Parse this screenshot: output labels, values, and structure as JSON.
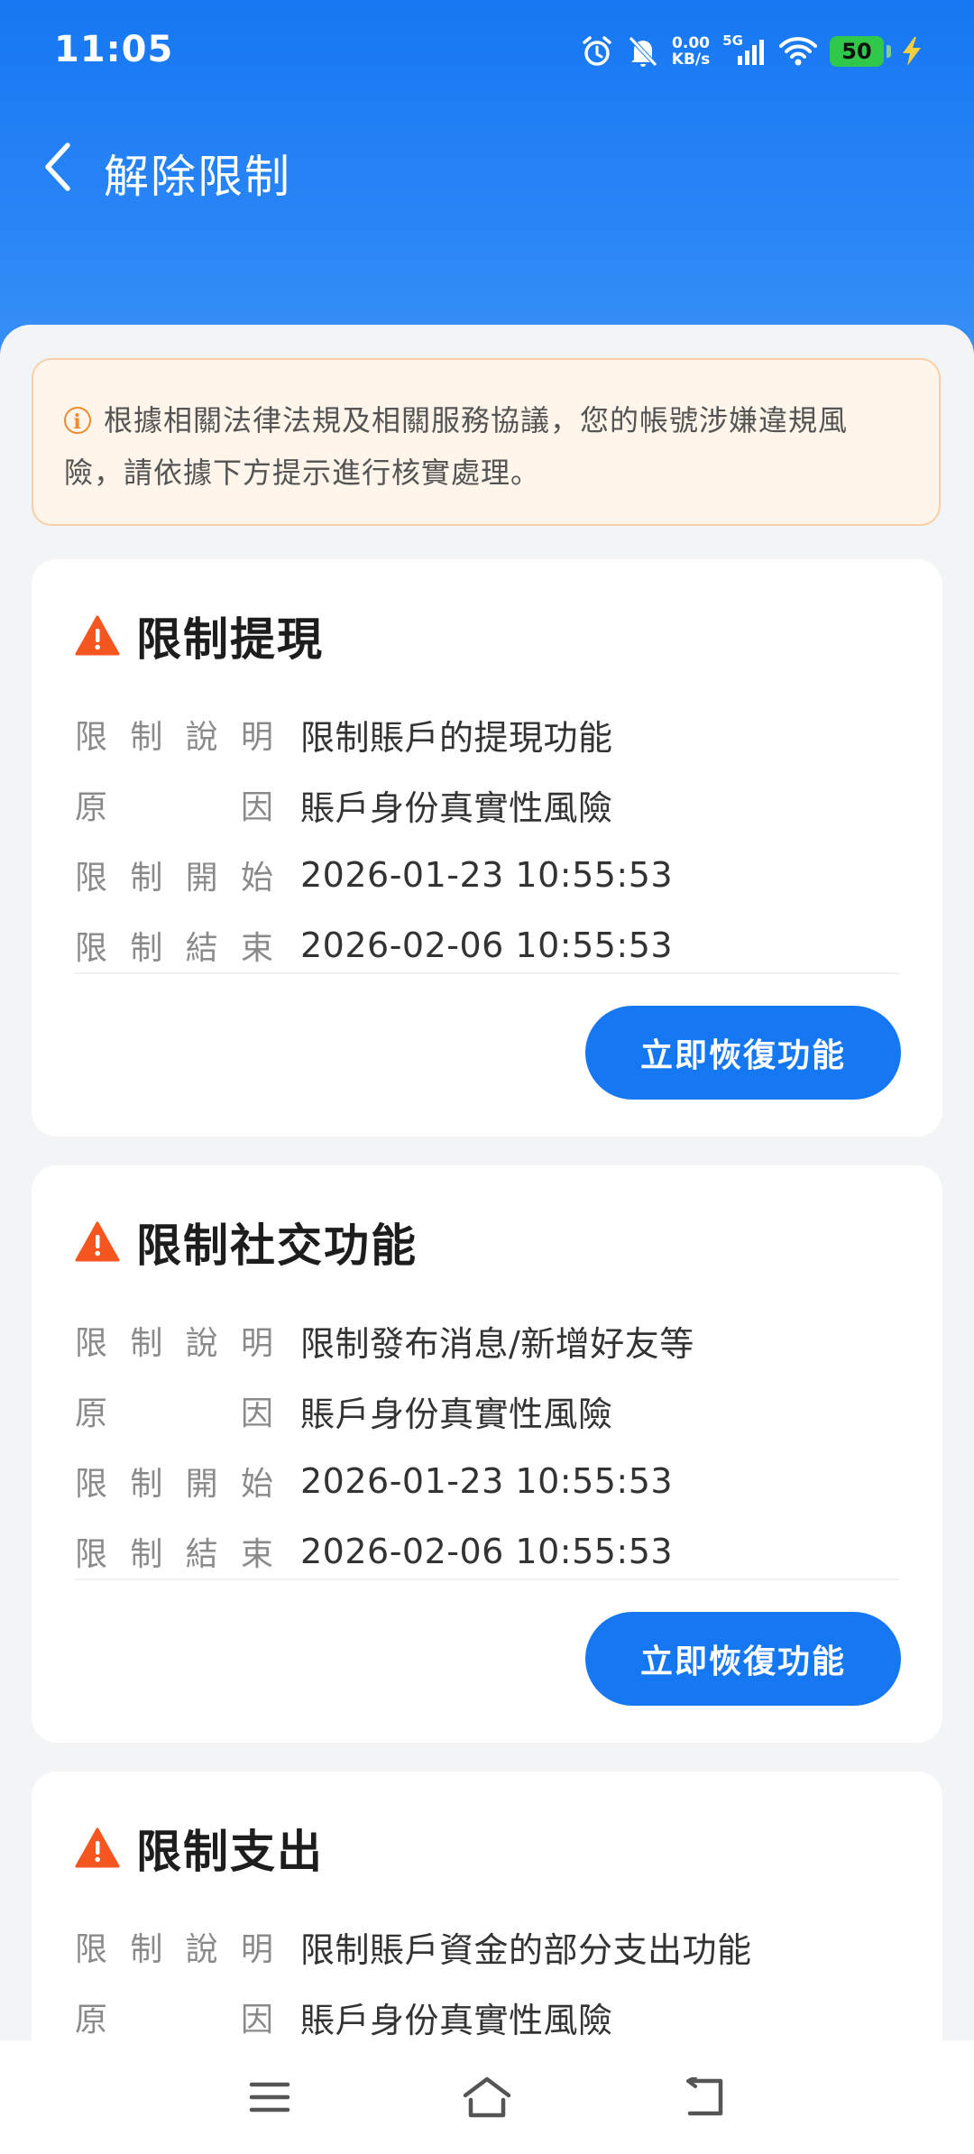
{
  "status_bar": {
    "time": "11:05",
    "net_speed_value": "0.00",
    "net_speed_unit": "KB/s",
    "signal_label": "5G",
    "battery_level": "50",
    "icons": [
      "alarm-icon",
      "bell-off-icon",
      "signal-icon",
      "wifi-icon",
      "battery-icon",
      "charging-icon"
    ]
  },
  "nav": {
    "back_icon": "chevron-left-icon",
    "title": "解除限制"
  },
  "notice": {
    "icon": "info-circle-icon",
    "text": "根據相關法律法規及相關服務協議，您的帳號涉嫌違規風險，請依據下方提示進行核實處理。"
  },
  "labels": {
    "desc": [
      "限",
      "制",
      "說",
      "明"
    ],
    "reason": [
      "原",
      "因"
    ],
    "start": [
      "限",
      "制",
      "開",
      "始"
    ],
    "end": [
      "限",
      "制",
      "結",
      "束"
    ]
  },
  "cards": [
    {
      "title": "限制提現",
      "description": "限制賬戶的提現功能",
      "reason": "賬戶身份真實性風險",
      "start": "2026-01-23 10:55:53",
      "end": "2026-02-06 10:55:53",
      "button": "立即恢復功能"
    },
    {
      "title": "限制社交功能",
      "description": "限制發布消息/新增好友等",
      "reason": "賬戶身份真實性風險",
      "start": "2026-01-23 10:55:53",
      "end": "2026-02-06 10:55:53",
      "button": "立即恢復功能"
    },
    {
      "title": "限制支出",
      "description": "限制賬戶資金的部分支出功能",
      "reason": "賬戶身份真實性風險"
    }
  ],
  "bottom_nav": {
    "icons": [
      "menu-icon",
      "home-icon",
      "back-icon"
    ]
  },
  "colors": {
    "primary": "#1677f2",
    "warning": "#f5561f",
    "notice_bg": "#fff5ea",
    "notice_border": "#f6cfa8"
  }
}
